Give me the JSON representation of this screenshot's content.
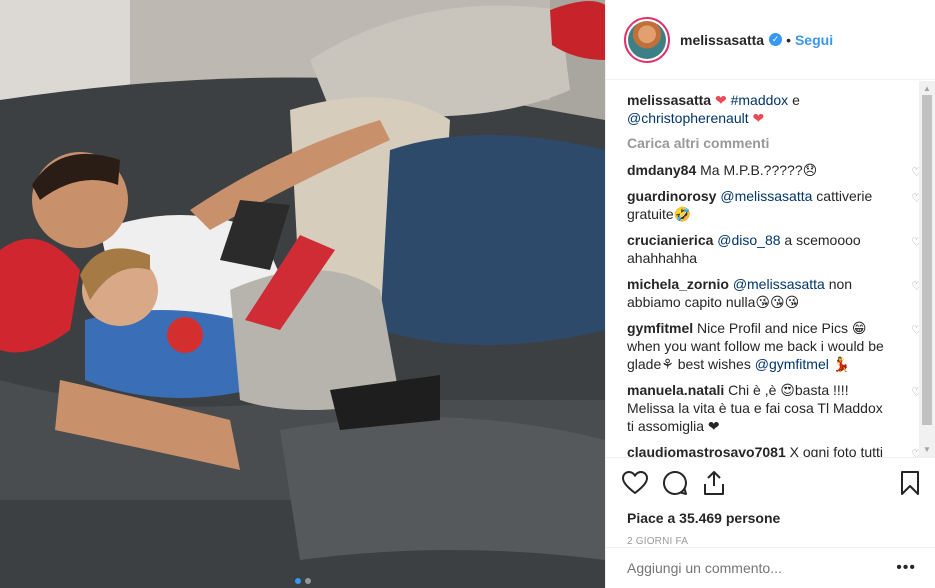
{
  "post": {
    "photo_alt": "",
    "carousel_dots": 2,
    "carousel_active": 1
  },
  "header": {
    "username": "melissasatta",
    "separator": "•",
    "follow_label": "Segui"
  },
  "caption": {
    "username": "melissasatta",
    "tag1": "#maddox",
    "conj": "e",
    "tag2": "@christopherenault"
  },
  "load_more": "Carica altri commenti",
  "comments": [
    {
      "user": "dmdany84",
      "parts": [
        {
          "t": "Ma M.P.B.?????😞"
        }
      ]
    },
    {
      "user": "guardinorosy",
      "parts": [
        {
          "t": "@melissasatta",
          "tag": true
        },
        {
          "t": " cattiverie gratuite🤣"
        }
      ]
    },
    {
      "user": "crucianierica",
      "parts": [
        {
          "t": "@diso_88",
          "tag": true
        },
        {
          "t": " a scemoooo ahahhahha"
        }
      ]
    },
    {
      "user": "michela_zornio",
      "parts": [
        {
          "t": "@melissasatta",
          "tag": true
        },
        {
          "t": " non abbiamo capito nulla😘😘😘"
        }
      ]
    },
    {
      "user": "gymfitmel",
      "parts": [
        {
          "t": "Nice Profil and nice Pics 😁 when you want follow me back i would be glade⚘ best wishes "
        },
        {
          "t": "@gymfitmel",
          "tag": true
        },
        {
          "t": " 💃"
        }
      ]
    },
    {
      "user": "manuela.natali",
      "parts": [
        {
          "t": "Chi è ,è 😍basta !!!! Melissa la vita è tua e fai cosa Tl Maddox ti assomiglia ❤"
        }
      ]
    },
    {
      "user": "claudiomastrosavo7081",
      "parts": [
        {
          "t": "X ogni foto tutti vogliono sindacare sulla vita degli"
        }
      ]
    }
  ],
  "likes": "Piace a 35.469 persone",
  "date": "2 GIORNI FA",
  "add_comment_placeholder": "Aggiungi un commento...",
  "more_label": "•••",
  "colors": {
    "link": "#003569",
    "accent": "#3897f0",
    "heart": "#ed4956",
    "muted": "#999999"
  }
}
